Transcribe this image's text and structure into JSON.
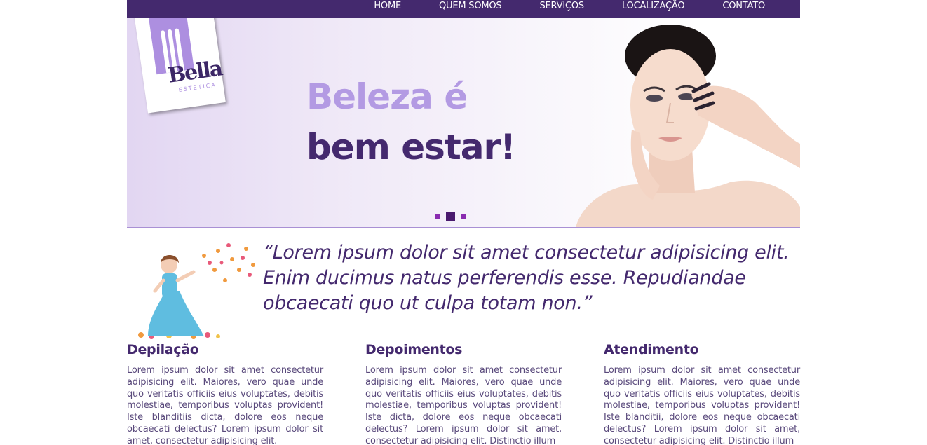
{
  "nav": {
    "items": [
      {
        "label": "HOME"
      },
      {
        "label": "QUEM SOMOS"
      },
      {
        "label": "SERVIÇOS"
      },
      {
        "label": "LOCALIZAÇÃO"
      },
      {
        "label": "CONTATO"
      }
    ]
  },
  "logo": {
    "name": "Bella",
    "subtitle": "ESTETICA"
  },
  "hero": {
    "slogan_line1": "Beleza é",
    "slogan_line2": "bem estar!",
    "slides_count": 3,
    "active_slide": 2
  },
  "quote": {
    "text": "“Lorem ipsum dolor sit amet consectetur adipisicing elit. Enim ducimus natus perferendis esse. Repudiandae obcaecati quo ut culpa totam non.”"
  },
  "columns": [
    {
      "title": "Depilação",
      "body": "Lorem ipsum dolor sit amet consectetur adipisicing elit. Maiores, vero quae unde quo veritatis officiis eius voluptates, debitis molestiae, temporibus voluptas provident! Iste blanditiis dicta, dolore eos neque obcaecati delectus? Lorem ipsum dolor sit amet, consectetur adipisicing elit."
    },
    {
      "title": "Depoimentos",
      "body": "Lorem ipsum dolor sit amet consectetur adipisicing elit. Maiores, vero quae unde quo veritatis officiis eius voluptates, debitis molestiae, temporibus voluptas provident! Iste dicta, dolore eos neque obcaecati delectus? Lorem ipsum dolor sit amet, consectetur adipisicing elit. Distinctio illum"
    },
    {
      "title": "Atendimento",
      "body": "Lorem ipsum dolor sit amet consectetur adipisicing elit. Maiores, vero quae unde quo veritatis officiis eius voluptates, debitis molestiae, temporibus voluptas provident! Iste blanditii, dolore eos neque obcaecati delectus? Lorem ipsum dolor sit amet, consectetur adipisicing elit. Distinctio illum"
    }
  ],
  "colors": {
    "primary": "#44296e",
    "accent_light": "#b39ae3",
    "slider_dot": "#8a2bb0"
  }
}
